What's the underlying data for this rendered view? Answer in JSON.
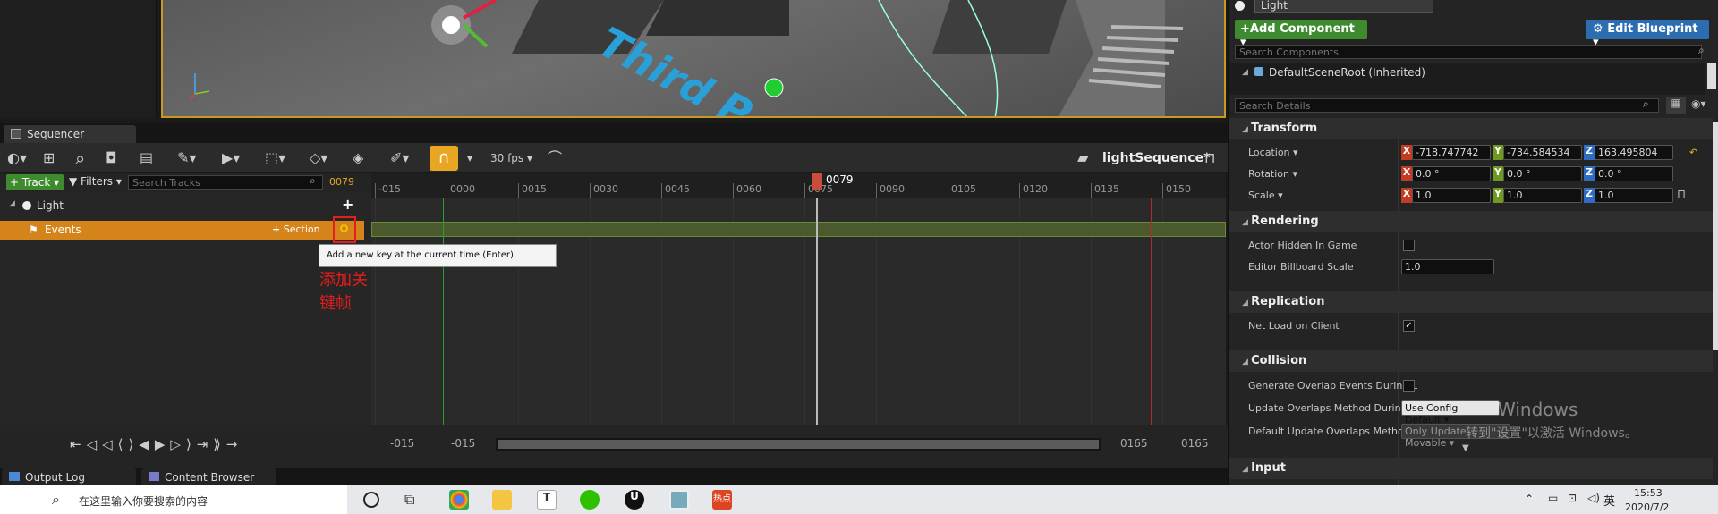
{
  "viewport": {
    "text_overlay": "Third P"
  },
  "sequencer": {
    "tab_label": "Sequencer",
    "fps_label": "30 fps",
    "sequence_name": "lightSequence*",
    "track_button": "Track",
    "filters_button": "Filters",
    "search_placeholder": "Search Tracks",
    "current_frame": "0079",
    "playhead_label": "0079",
    "tracks": [
      {
        "label": "Light"
      },
      {
        "label": "Events",
        "section_label": "Section"
      }
    ],
    "tooltip": "Add a new key at the current time (Enter)",
    "annotation": "添加关键帧",
    "ruler_ticks": [
      "-015",
      "0000",
      "0015",
      "0030",
      "0045",
      "0060",
      "0075",
      "0090",
      "0105",
      "0120",
      "0135",
      "0150"
    ],
    "range": {
      "view_start": "-015",
      "work_start": "-015",
      "work_end": "0165",
      "view_end": "0165"
    }
  },
  "bottom_tabs": [
    {
      "label": "Output Log"
    },
    {
      "label": "Content Browser"
    }
  ],
  "details": {
    "name_field": "Light",
    "add_component": "Add Component",
    "edit_blueprint": "Edit Blueprint",
    "search_components_placeholder": "Search Components",
    "component_root": "DefaultSceneRoot (Inherited)",
    "search_details_placeholder": "Search Details",
    "sections": {
      "transform": "Transform",
      "rendering": "Rendering",
      "replication": "Replication",
      "collision": "Collision",
      "input": "Input"
    },
    "transform": {
      "location_label": "Location",
      "rotation_label": "Rotation",
      "scale_label": "Scale",
      "location": [
        "-718.747742",
        "-734.584534",
        "163.495804"
      ],
      "rotation": [
        "0.0 °",
        "0.0 °",
        "0.0 °"
      ],
      "scale": [
        "1.0",
        "1.0",
        "1.0"
      ]
    },
    "rendering": {
      "actor_hidden": "Actor Hidden In Game",
      "billboard_scale_label": "Editor Billboard Scale",
      "billboard_scale": "1.0"
    },
    "replication": {
      "net_load": "Net Load on Client"
    },
    "collision": {
      "gen_overlap": "Generate Overlap Events During L",
      "update_method_label": "Update Overlaps Method During L",
      "update_method_value": "Use Config Default",
      "default_method_label": "Default Update Overlaps Method",
      "default_method_value": "Only Update Movable"
    },
    "watermark_line1": "Windows",
    "watermark_line2": "转到\"设置\"以激活 Windows。"
  },
  "taskbar": {
    "search_text": "在这里输入你要搜索的内容",
    "lang": "英",
    "time": "15:53",
    "date": "2020/7/2"
  },
  "colors": {
    "accent_orange": "#e8a623",
    "track_highlight": "#d4841a",
    "add_green": "#3d8b2e",
    "blueprint_blue": "#2c6cb0",
    "axis_x": "#c23b22",
    "axis_y": "#6e9a1f",
    "axis_z": "#2f6cc2"
  }
}
